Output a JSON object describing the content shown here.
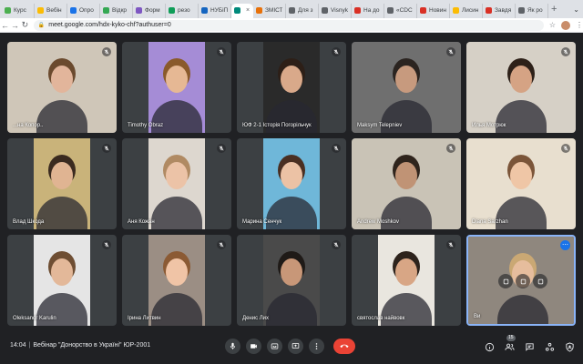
{
  "browser": {
    "tabs": [
      {
        "label": "Курс",
        "color": "#4caf50"
      },
      {
        "label": "Вебін",
        "color": "#fbbc04"
      },
      {
        "label": "Опрo",
        "color": "#1a73e8"
      },
      {
        "label": "Відкр",
        "color": "#34a853"
      },
      {
        "label": "Форм",
        "color": "#7e57c2"
      },
      {
        "label": "резо",
        "color": "#0f9d58"
      },
      {
        "label": "НУБіП",
        "color": "#1565c0"
      },
      {
        "label": "",
        "color": "#00897b",
        "active": true
      },
      {
        "label": "ЗМІСТ",
        "color": "#e8710a"
      },
      {
        "label": "Для з",
        "color": "#5f6368"
      },
      {
        "label": "Visnyk",
        "color": "#5f6368"
      },
      {
        "label": "На до",
        "color": "#d93025"
      },
      {
        "label": "«СDС",
        "color": "#5f6368"
      },
      {
        "label": "Новин",
        "color": "#d93025"
      },
      {
        "label": "Лисин",
        "color": "#fbbc04"
      },
      {
        "label": "Завдя",
        "color": "#d93025"
      },
      {
        "label": "Як ро",
        "color": "#5f6368"
      }
    ],
    "url": "meet.google.com/hdx-kyko-chf?authuser=0"
  },
  "participants": [
    {
      "name": "...на Копор..",
      "bg": "#cfc6b8",
      "skin": "#e2b59b",
      "hair": "#6b4a2e"
    },
    {
      "name": "Timothy Obraz",
      "bg": "#a58cd6",
      "skin": "#e6b894",
      "hair": "#8a5a2b"
    },
    {
      "name": "ЮФ 2-1 Історія Погорільчук",
      "bg": "#2a2a2a",
      "skin": "#d9a98a",
      "hair": "#2d1f17"
    },
    {
      "name": "Maksym Telepniev",
      "bg": "#6f6f6f",
      "skin": "#c79a7e",
      "hair": "#2b2420"
    },
    {
      "name": "Илья Мотрюк",
      "bg": "#d6d0c6",
      "skin": "#d5a384",
      "hair": "#2e2119"
    },
    {
      "name": "Влад Шкода",
      "bg": "#c9b37a",
      "skin": "#e0b492",
      "hair": "#3a2a1f"
    },
    {
      "name": "Аня Кожан",
      "bg": "#ddd7cf",
      "skin": "#ecc3a7",
      "hair": "#b08a63"
    },
    {
      "name": "Марина Сенчук",
      "bg": "#6fb7d9",
      "skin": "#ecc2a5",
      "hair": "#4a2f22"
    },
    {
      "name": "Andrew Moshkov",
      "bg": "#c9c3b6",
      "skin": "#c09375",
      "hair": "#2f241c"
    },
    {
      "name": "Diana Sarzhan",
      "bg": "#e8dfcf",
      "skin": "#efc6a6",
      "hair": "#7b5539"
    },
    {
      "name": "Oleksandr Karulin",
      "bg": "#e5e5e5",
      "skin": "#e3b899",
      "hair": "#6e4e33"
    },
    {
      "name": "Ірина Литвин",
      "bg": "#9b8e84",
      "skin": "#f0c4a6",
      "hair": "#8b5a34"
    },
    {
      "name": "Денис Лих",
      "bg": "#4a4a4a",
      "skin": "#c89778",
      "hair": "#1f1a17"
    },
    {
      "name": "святослав найвовк",
      "bg": "#e9e6df",
      "skin": "#d8a685",
      "hair": "#2d231c"
    },
    {
      "name": "Ви",
      "bg": "#8f877e",
      "skin": "#e6bd9d",
      "hair": "#caa874",
      "self": true
    }
  ],
  "meeting": {
    "time": "14:04",
    "title": "Вебінар \"Донорство в Україні\" ЮР-2001",
    "participant_count": "15"
  },
  "icons": {
    "mic": "mic-icon",
    "camera": "camera-icon",
    "captions": "captions-icon",
    "present": "present-icon",
    "more": "more-icon",
    "hangup": "hangup-icon",
    "info": "info-icon",
    "people": "people-icon",
    "chat": "chat-icon",
    "activities": "activities-icon",
    "host": "host-controls-icon"
  }
}
